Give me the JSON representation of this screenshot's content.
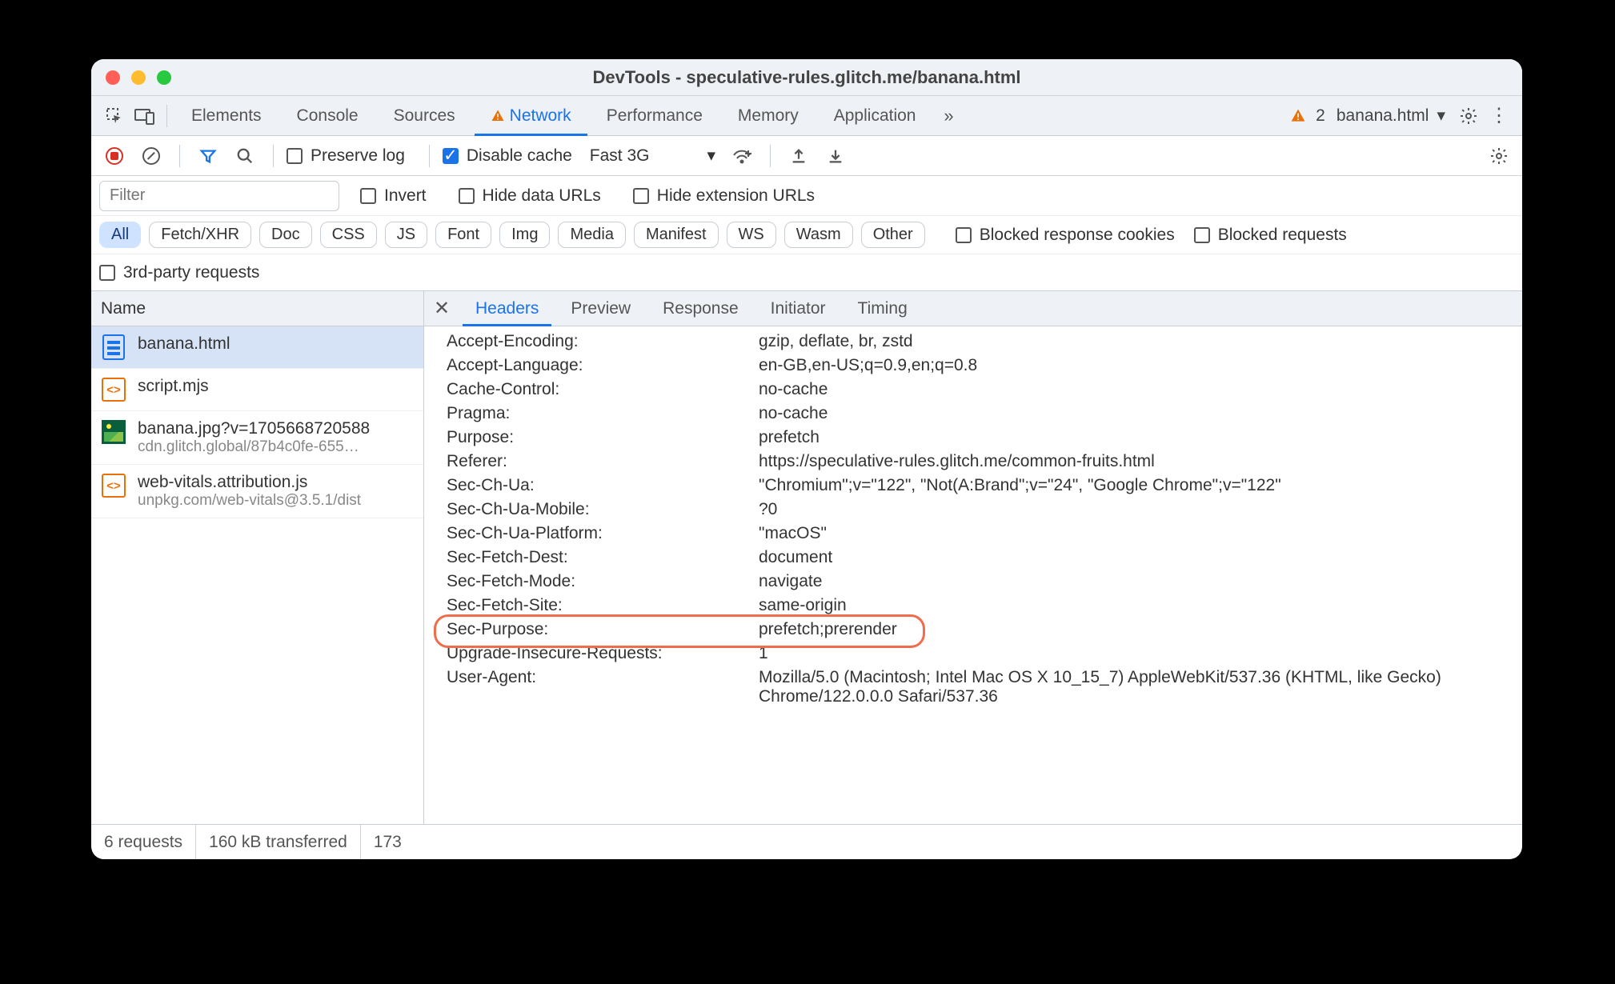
{
  "window": {
    "title": "DevTools - speculative-rules.glitch.me/banana.html"
  },
  "tabs": {
    "items": [
      "Elements",
      "Console",
      "Sources",
      "Network",
      "Performance",
      "Memory",
      "Application"
    ],
    "active": "Network",
    "warning_on": "Network",
    "error_count": "2",
    "target": "banana.html"
  },
  "toolbar": {
    "preserve_log": "Preserve log",
    "disable_cache": "Disable cache",
    "throttling": "Fast 3G"
  },
  "filter": {
    "placeholder": "Filter",
    "invert": "Invert",
    "hide_data_urls": "Hide data URLs",
    "hide_ext_urls": "Hide extension URLs"
  },
  "types": [
    "All",
    "Fetch/XHR",
    "Doc",
    "CSS",
    "JS",
    "Font",
    "Img",
    "Media",
    "Manifest",
    "WS",
    "Wasm",
    "Other"
  ],
  "type_active": "All",
  "more_filters": {
    "blocked_response_cookies": "Blocked response cookies",
    "blocked_requests": "Blocked requests",
    "third_party": "3rd-party requests"
  },
  "left": {
    "header": "Name",
    "requests": [
      {
        "name": "banana.html",
        "sub": "",
        "icon": "doc",
        "selected": true
      },
      {
        "name": "script.mjs",
        "sub": "",
        "icon": "js",
        "selected": false
      },
      {
        "name": "banana.jpg?v=1705668720588",
        "sub": "cdn.glitch.global/87b4c0fe-655…",
        "icon": "img",
        "selected": false
      },
      {
        "name": "web-vitals.attribution.js",
        "sub": "unpkg.com/web-vitals@3.5.1/dist",
        "icon": "js",
        "selected": false
      }
    ]
  },
  "detail_tabs": {
    "items": [
      "Headers",
      "Preview",
      "Response",
      "Initiator",
      "Timing"
    ],
    "active": "Headers"
  },
  "headers": [
    {
      "name": "Accept-Encoding:",
      "value": "gzip, deflate, br, zstd"
    },
    {
      "name": "Accept-Language:",
      "value": "en-GB,en-US;q=0.9,en;q=0.8"
    },
    {
      "name": "Cache-Control:",
      "value": "no-cache"
    },
    {
      "name": "Pragma:",
      "value": "no-cache"
    },
    {
      "name": "Purpose:",
      "value": "prefetch"
    },
    {
      "name": "Referer:",
      "value": "https://speculative-rules.glitch.me/common-fruits.html"
    },
    {
      "name": "Sec-Ch-Ua:",
      "value": "\"Chromium\";v=\"122\", \"Not(A:Brand\";v=\"24\", \"Google Chrome\";v=\"122\""
    },
    {
      "name": "Sec-Ch-Ua-Mobile:",
      "value": "?0"
    },
    {
      "name": "Sec-Ch-Ua-Platform:",
      "value": "\"macOS\""
    },
    {
      "name": "Sec-Fetch-Dest:",
      "value": "document"
    },
    {
      "name": "Sec-Fetch-Mode:",
      "value": "navigate"
    },
    {
      "name": "Sec-Fetch-Site:",
      "value": "same-origin"
    },
    {
      "name": "Sec-Purpose:",
      "value": "prefetch;prerender",
      "highlight": true
    },
    {
      "name": "Upgrade-Insecure-Requests:",
      "value": "1"
    },
    {
      "name": "User-Agent:",
      "value": "Mozilla/5.0 (Macintosh; Intel Mac OS X 10_15_7) AppleWebKit/537.36 (KHTML, like Gecko) Chrome/122.0.0.0 Safari/537.36"
    }
  ],
  "status": {
    "requests": "6 requests",
    "transferred": "160 kB transferred",
    "resources": "173"
  }
}
